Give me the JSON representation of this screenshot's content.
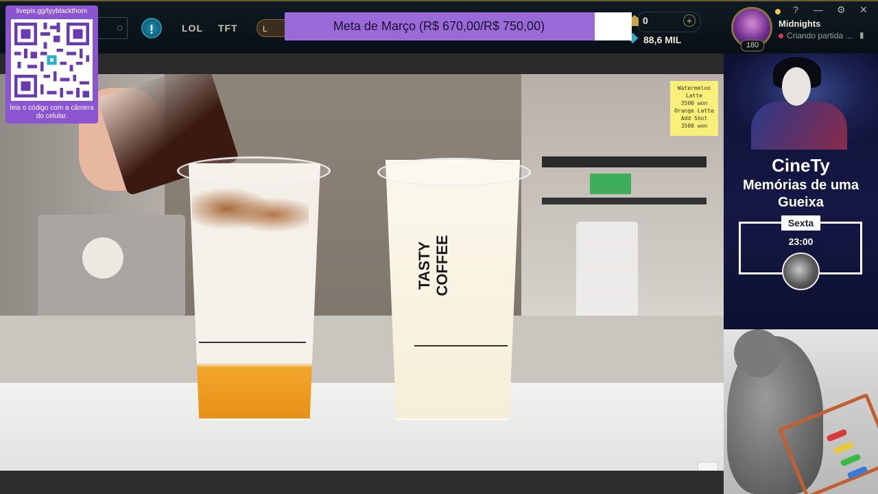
{
  "client": {
    "nav_tabs": [
      {
        "label": "LOL"
      },
      {
        "label": "TFT"
      }
    ],
    "play_box_text": "O",
    "loot_label": "L",
    "riot_points": "0",
    "blue_essence": "88,6 MIL"
  },
  "donation_goal": {
    "label": "Meta de Março (R$ 670,00/R$ 750,00)",
    "current": 670,
    "target": 750,
    "fill_color": "#9a6ad8"
  },
  "profile": {
    "username": "Midnights",
    "status": "Criando partida ...",
    "level": "180"
  },
  "window_controls": {
    "help": "?",
    "minimize": "—",
    "settings": "⚙",
    "close": "✕"
  },
  "qr_overlay": {
    "url": "livepix.gg/tyyblackthorn",
    "caption": "leia o código com a câmera do celular."
  },
  "video": {
    "cup_brand": "TASTY COFFEE",
    "menu_note": [
      "Watermelon",
      "Latte",
      "3500 won",
      "Orange Latte",
      "Add Shot",
      "3500 won"
    ]
  },
  "side_panel": {
    "brand": "CineTy",
    "title": "Memórias de uma Gueixa",
    "day": "Sexta",
    "time": "23:00"
  },
  "colors": {
    "accent_gold": "#c8a246",
    "panel_bg": "#141845",
    "status_red": "#d23a4a"
  }
}
